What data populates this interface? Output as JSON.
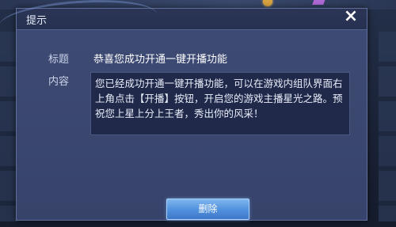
{
  "dialog": {
    "title": "提示",
    "subject_label": "标题",
    "subject_value": "恭喜您成功开通一键开播功能",
    "content_label": "内容",
    "content_text": "您已经成功开通一键开播功能，可以在游戏内组队界面右上角点击【开播】按钮，开启您的游戏主播星光之路。预祝您上星上分上王者，秀出你的风采！",
    "delete_label": "删除",
    "close_icon": "×"
  },
  "colors": {
    "dialog_bg": "#3b4870",
    "title_bar": "#2a3454",
    "content_bg": "#21294a",
    "button": "#5a9ae4"
  },
  "icons": {
    "close": "close-icon"
  }
}
